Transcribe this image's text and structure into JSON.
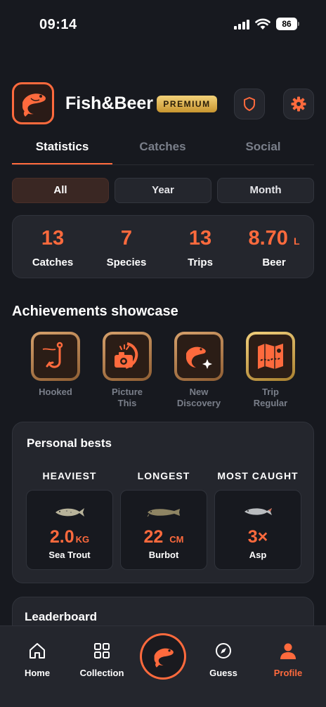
{
  "status_bar": {
    "time": "09:14",
    "battery": "86"
  },
  "header": {
    "app_name": "Fish&Beer",
    "premium_label": "PREMIUM"
  },
  "tabs": [
    {
      "label": "Statistics",
      "active": true
    },
    {
      "label": "Catches",
      "active": false
    },
    {
      "label": "Social",
      "active": false
    }
  ],
  "filters": [
    {
      "label": "All",
      "active": true
    },
    {
      "label": "Year",
      "active": false
    },
    {
      "label": "Month",
      "active": false
    }
  ],
  "stats": {
    "catches": {
      "value": "13",
      "label": "Catches"
    },
    "species": {
      "value": "7",
      "label": "Species"
    },
    "trips": {
      "value": "13",
      "label": "Trips"
    },
    "beer": {
      "value": "8.70",
      "unit": "L",
      "label": "Beer"
    }
  },
  "achievements": {
    "title": "Achievements showcase",
    "items": [
      {
        "line1": "Hooked",
        "line2": "",
        "icon": "hook-icon"
      },
      {
        "line1": "Picture",
        "line2": "This",
        "icon": "camera-icon"
      },
      {
        "line1": "New",
        "line2": "Discovery",
        "icon": "fish-sparkle-icon"
      },
      {
        "line1": "Trip",
        "line2": "Regular",
        "icon": "map-icon"
      }
    ]
  },
  "personal_bests": {
    "title": "Personal bests",
    "columns": [
      {
        "heading": "HEAVIEST",
        "value": "2.0",
        "unit": "KG",
        "species": "Sea Trout"
      },
      {
        "heading": "LONGEST",
        "value": "22",
        "unit": "CM",
        "species": "Burbot"
      },
      {
        "heading": "MOST CAUGHT",
        "value": "3×",
        "unit": "",
        "species": "Asp"
      }
    ]
  },
  "leaderboard": {
    "title": "Leaderboard"
  },
  "tabbar": {
    "home": "Home",
    "collection": "Collection",
    "guess": "Guess",
    "profile": "Profile"
  },
  "colors": {
    "accent": "#ff6a3d",
    "background": "#17191f",
    "card": "#24262d",
    "muted": "#7a7f8a",
    "premium_gold": "#e0b552"
  }
}
